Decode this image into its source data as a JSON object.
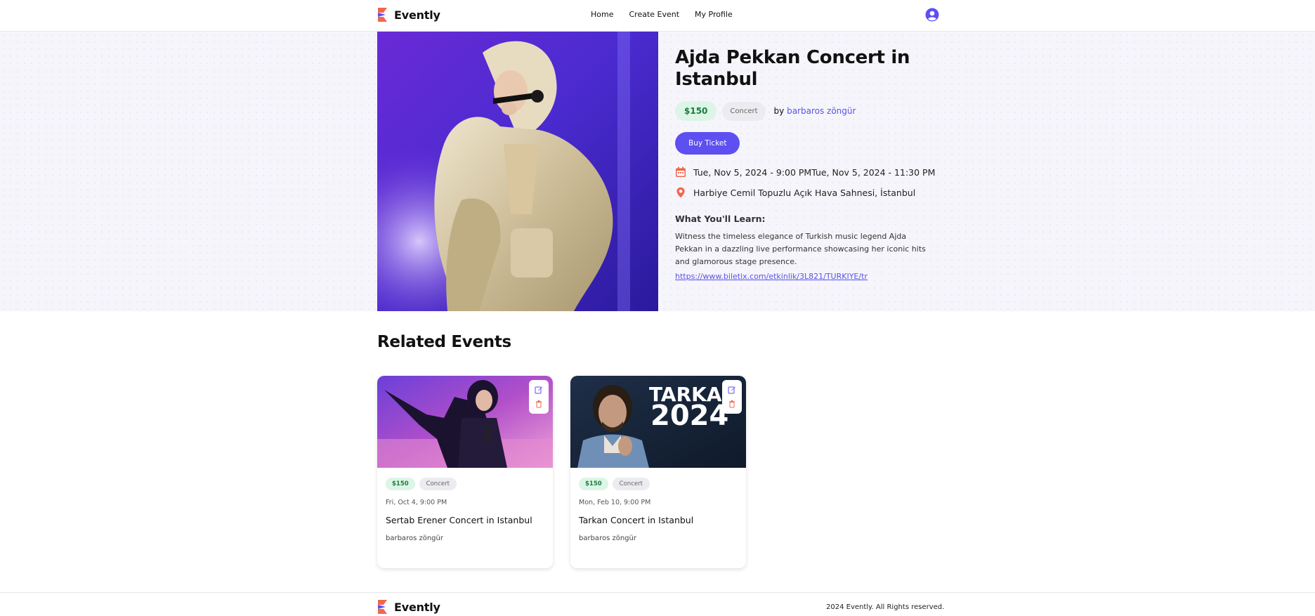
{
  "header": {
    "brand": "Evently",
    "nav": [
      "Home",
      "Create Event",
      "My Profile"
    ]
  },
  "event": {
    "title": "Ajda Pekkan Concert in Istanbul",
    "price": "$150",
    "category": "Concert",
    "by_label": "by",
    "organizer": "barbaros zöngür",
    "buy_label": "Buy Ticket",
    "datetime": "Tue, Nov 5, 2024 - 9:00 PMTue, Nov 5, 2024 - 11:30 PM",
    "location": "Harbiye Cemil Topuzlu Açık Hava Sahnesi, İstanbul",
    "learn_heading": "What You'll Learn:",
    "description": "Witness the timeless elegance of Turkish music legend Ajda Pekkan in a dazzling live performance showcasing her iconic hits and glamorous stage presence.",
    "url": "https://www.biletix.com/etkinlik/3L821/TURKIYE/tr"
  },
  "related": {
    "heading": "Related Events",
    "cards": [
      {
        "price": "$150",
        "category": "Concert",
        "date": "Fri, Oct 4, 9:00 PM",
        "title": "Sertab Erener Concert in Istanbul",
        "organizer": "barbaros zöngür"
      },
      {
        "price": "$150",
        "category": "Concert",
        "date": "Mon, Feb 10, 9:00 PM",
        "title": "Tarkan Concert in Istanbul",
        "organizer": "barbaros zöngür",
        "poster_text": [
          "TARKAN",
          "2024"
        ]
      }
    ]
  },
  "footer": {
    "brand": "Evently",
    "copyright": "2024 Evently. All Rights reserved."
  },
  "colors": {
    "accent": "#5d4ff0",
    "price_bg": "#dcf5e6",
    "price_text": "#1e7a3e",
    "delete_icon": "#f0674f"
  },
  "icons": [
    "evently-logo-icon",
    "user-avatar-icon",
    "calendar-icon",
    "location-pin-icon",
    "edit-icon",
    "delete-icon"
  ]
}
